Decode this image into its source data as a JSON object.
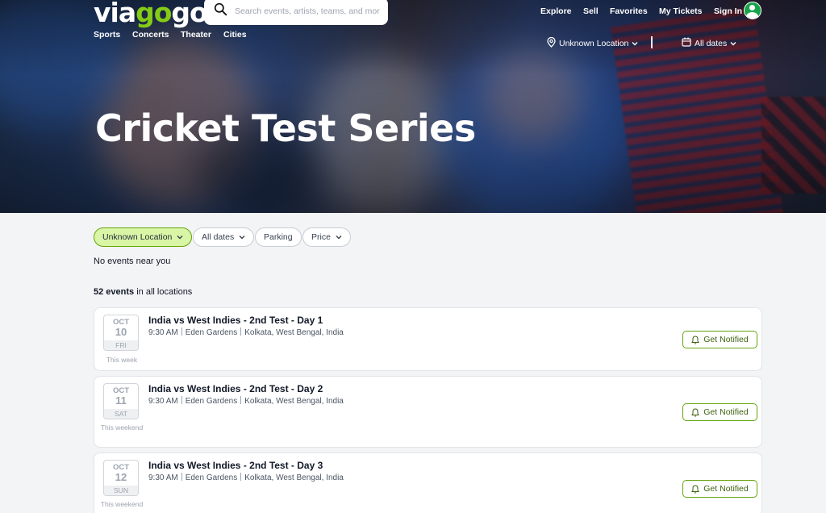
{
  "header": {
    "logo_via": "via",
    "logo_go": "go",
    "logo_go2": "go",
    "search_placeholder": "Search events, artists, teams, and more",
    "nav": [
      "Explore",
      "Sell",
      "Favorites",
      "My Tickets",
      "Sign In"
    ],
    "categories": [
      "Sports",
      "Concerts",
      "Theater",
      "Cities"
    ],
    "location_label": "Unknown Location",
    "dates_label": "All dates"
  },
  "hero": {
    "title": "Cricket Test Series"
  },
  "filters": {
    "location": "Unknown Location",
    "dates": "All dates",
    "parking": "Parking",
    "price": "Price"
  },
  "no_events_text": "No events near you",
  "events_count": "52 events",
  "events_count_suffix": " in all locations",
  "events": [
    {
      "month": "OCT",
      "day": "10",
      "dow": "FRI",
      "when": "This week",
      "title": "India vs West Indies - 2nd Test - Day 1",
      "time": "9:30 AM",
      "venue": "Eden Gardens",
      "city": "Kolkata, West Bengal, India",
      "action": "Get Notified"
    },
    {
      "month": "OCT",
      "day": "11",
      "dow": "SAT",
      "when": "This weekend",
      "title": "India vs West Indies - 2nd Test - Day 2",
      "time": "9:30 AM",
      "venue": "Eden Gardens",
      "city": "Kolkata, West Bengal, India",
      "action": "Get Notified"
    },
    {
      "month": "OCT",
      "day": "12",
      "dow": "SUN",
      "when": "This weekend",
      "title": "India vs West Indies - 2nd Test - Day 3",
      "time": "9:30 AM",
      "venue": "Eden Gardens",
      "city": "Kolkata, West Bengal, India",
      "action": "Get Notified"
    }
  ],
  "colors": {
    "accent": "#65a30d",
    "chip_active_bg": "#d9f5a6",
    "avatar": "#16a34a"
  }
}
